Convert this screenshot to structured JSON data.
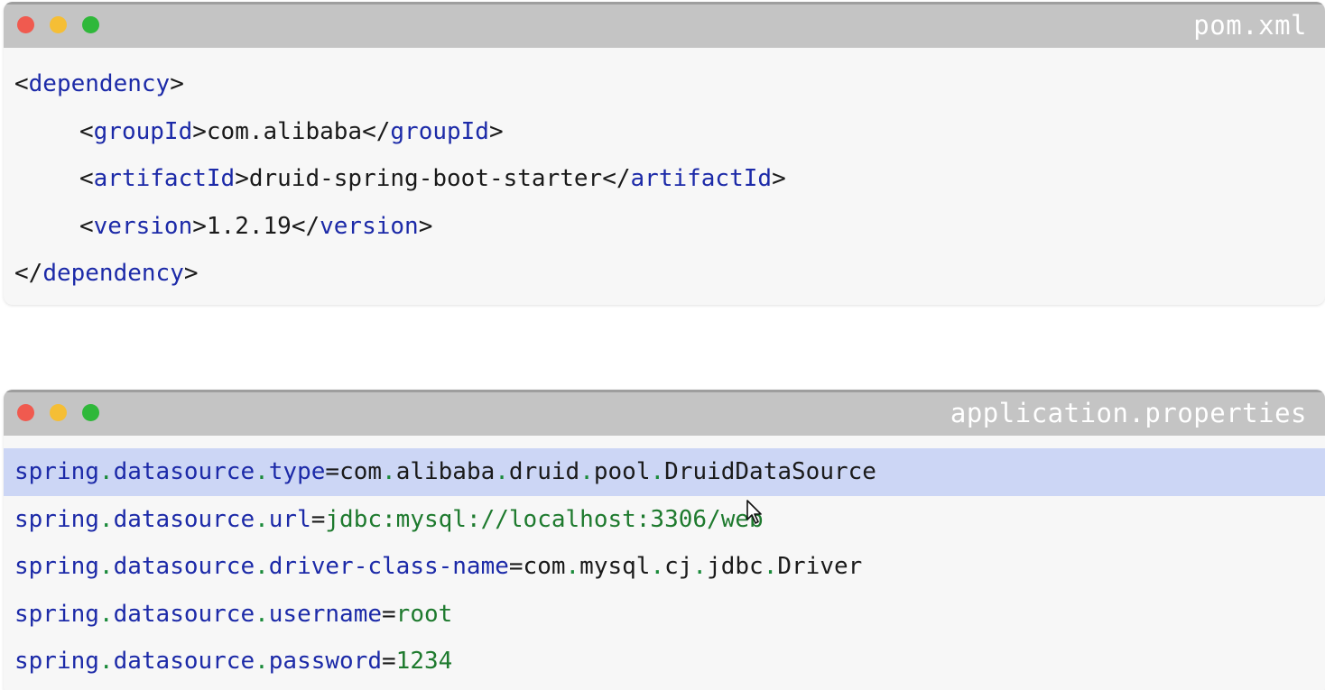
{
  "windows": [
    {
      "title": "pom.xml",
      "lines": [
        {
          "parts": [
            [
              "tag",
              "<"
            ],
            [
              "name",
              "dependency"
            ],
            [
              "tag",
              ">"
            ]
          ]
        },
        {
          "indent": true,
          "parts": [
            [
              "tag",
              "<"
            ],
            [
              "name",
              "groupId"
            ],
            [
              "tag",
              ">"
            ],
            [
              "text",
              "com.alibaba"
            ],
            [
              "tag",
              "</"
            ],
            [
              "name",
              "groupId"
            ],
            [
              "tag",
              ">"
            ]
          ]
        },
        {
          "indent": true,
          "parts": [
            [
              "tag",
              "<"
            ],
            [
              "name",
              "artifactId"
            ],
            [
              "tag",
              ">"
            ],
            [
              "text",
              "druid-spring-boot-starter"
            ],
            [
              "tag",
              "</"
            ],
            [
              "name",
              "artifactId"
            ],
            [
              "tag",
              ">"
            ]
          ]
        },
        {
          "indent": true,
          "parts": [
            [
              "tag",
              "<"
            ],
            [
              "name",
              "version"
            ],
            [
              "tag",
              ">"
            ],
            [
              "text",
              "1.2.19"
            ],
            [
              "tag",
              "</"
            ],
            [
              "name",
              "version"
            ],
            [
              "tag",
              ">"
            ]
          ]
        },
        {
          "parts": [
            [
              "tag",
              "</"
            ],
            [
              "name",
              "dependency"
            ],
            [
              "tag",
              ">"
            ]
          ]
        }
      ]
    },
    {
      "title": "application.properties",
      "lines": [
        {
          "highlight": true,
          "parts": [
            [
              "key",
              "spring"
            ],
            [
              "dot",
              "."
            ],
            [
              "key",
              "datasource"
            ],
            [
              "dot",
              "."
            ],
            [
              "key",
              "type"
            ],
            [
              "eq",
              "="
            ],
            [
              "val",
              "com"
            ],
            [
              "dot",
              "."
            ],
            [
              "val",
              "alibaba"
            ],
            [
              "dot",
              "."
            ],
            [
              "val",
              "druid"
            ],
            [
              "dot",
              "."
            ],
            [
              "val",
              "pool"
            ],
            [
              "dot",
              "."
            ],
            [
              "val",
              "DruidDataSource"
            ]
          ]
        },
        {
          "parts": [
            [
              "key",
              "spring"
            ],
            [
              "dot",
              "."
            ],
            [
              "key",
              "datasource"
            ],
            [
              "dot",
              "."
            ],
            [
              "key",
              "url"
            ],
            [
              "eq",
              "="
            ],
            [
              "green",
              "jdbc:mysql://localhost:3306/web"
            ]
          ]
        },
        {
          "parts": [
            [
              "key",
              "spring"
            ],
            [
              "dot",
              "."
            ],
            [
              "key",
              "datasource"
            ],
            [
              "dot",
              "."
            ],
            [
              "key",
              "driver-class-name"
            ],
            [
              "eq",
              "="
            ],
            [
              "val",
              "com"
            ],
            [
              "dot",
              "."
            ],
            [
              "val",
              "mysql"
            ],
            [
              "dot",
              "."
            ],
            [
              "val",
              "cj"
            ],
            [
              "dot",
              "."
            ],
            [
              "val",
              "jdbc"
            ],
            [
              "dot",
              "."
            ],
            [
              "val",
              "Driver"
            ]
          ]
        },
        {
          "parts": [
            [
              "key",
              "spring"
            ],
            [
              "dot",
              "."
            ],
            [
              "key",
              "datasource"
            ],
            [
              "dot",
              "."
            ],
            [
              "key",
              "username"
            ],
            [
              "eq",
              "="
            ],
            [
              "green",
              "root"
            ]
          ]
        },
        {
          "parts": [
            [
              "key",
              "spring"
            ],
            [
              "dot",
              "."
            ],
            [
              "key",
              "datasource"
            ],
            [
              "dot",
              "."
            ],
            [
              "key",
              "password"
            ],
            [
              "eq",
              "="
            ],
            [
              "green",
              "1234"
            ]
          ]
        }
      ]
    }
  ],
  "colors": {
    "titlebar": "#c4c4c4",
    "editor_bg": "#f7f7f7",
    "highlight": "#ccd6f5",
    "keyword_blue": "#1c2aa8",
    "value_green": "#1e7a2e",
    "close": "#f05a4f",
    "minimize": "#f5be35",
    "maximize": "#2fb83a"
  }
}
